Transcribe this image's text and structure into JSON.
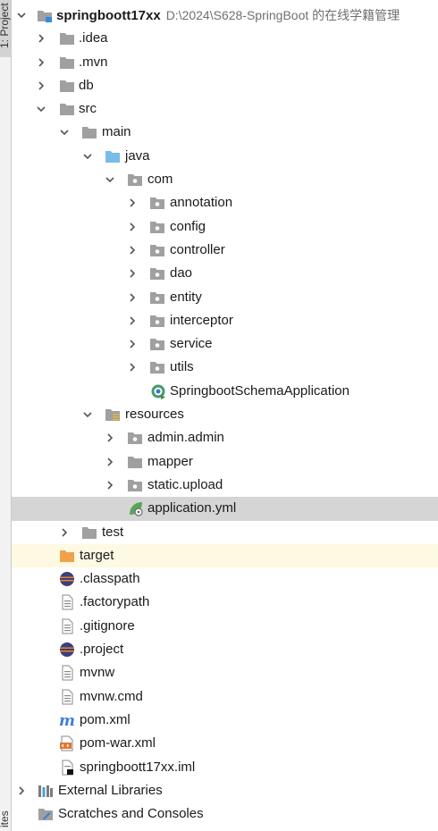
{
  "sidebar": {
    "project_tab": "1: Project",
    "bottom_tab": "ites"
  },
  "tree": {
    "root": {
      "name": "springboott17xx",
      "path": "D:\\2024\\S628-SpringBoot 的在线学籍管理"
    },
    "idea": ".idea",
    "mvn": ".mvn",
    "db": "db",
    "src": "src",
    "main": "main",
    "java": "java",
    "com": "com",
    "annotation": "annotation",
    "config": "config",
    "controller": "controller",
    "dao": "dao",
    "entity": "entity",
    "interceptor": "interceptor",
    "service": "service",
    "utils": "utils",
    "app_class": "SpringbootSchemaApplication",
    "resources": "resources",
    "admin": "admin.admin",
    "mapper": "mapper",
    "static_upload": "static.upload",
    "app_yml": "application.yml",
    "test": "test",
    "target": "target",
    "classpath": ".classpath",
    "factorypath": ".factorypath",
    "gitignore": ".gitignore",
    "project": ".project",
    "mvnw": "mvnw",
    "mvnw_cmd": "mvnw.cmd",
    "pom": "pom.xml",
    "pom_war": "pom-war.xml",
    "iml": "springboott17xx.iml",
    "ext_libs": "External Libraries",
    "scratches": "Scratches and Consoles"
  },
  "colors": {
    "folder": "#a0a0a0",
    "source_folder": "#78bde8",
    "excluded_folder": "#f0a24b",
    "selected_row": "#d5d5d5",
    "excluded_row": "#fdf9e3"
  }
}
